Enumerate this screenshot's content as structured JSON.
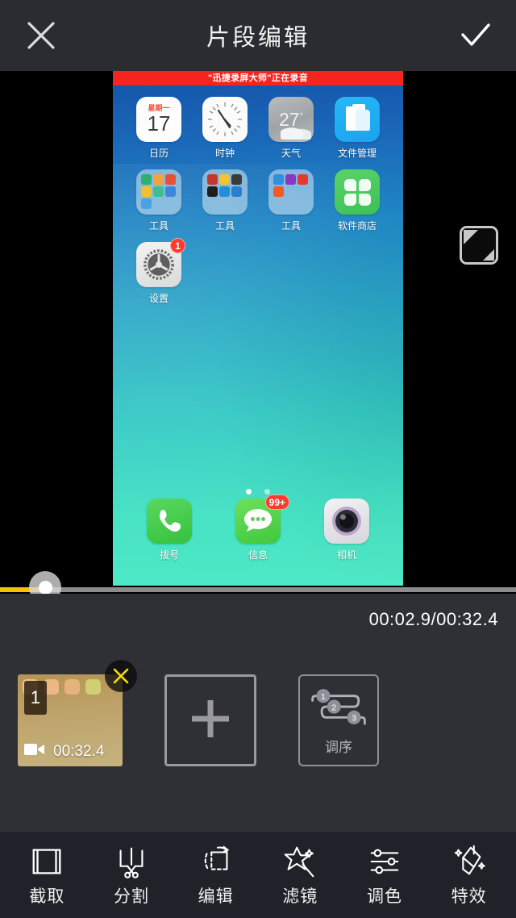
{
  "header": {
    "title": "片段编辑",
    "close_icon": "close-x-icon",
    "confirm_icon": "check-icon"
  },
  "corner_button": {
    "icon": "contrast-split-icon"
  },
  "preview": {
    "recording_banner": "\"迅捷录屏大师\"正在录音",
    "rows": [
      [
        {
          "label": "日历",
          "icon": "calendar-icon",
          "weekday": "星期一",
          "day": "17"
        },
        {
          "label": "时钟",
          "icon": "clock-icon"
        },
        {
          "label": "天气",
          "icon": "weather-icon",
          "temp": "27",
          "deg": "°"
        },
        {
          "label": "文件管理",
          "icon": "file-manager-icon"
        }
      ],
      [
        {
          "label": "工具",
          "icon": "folder-icon"
        },
        {
          "label": "工具",
          "icon": "folder-icon"
        },
        {
          "label": "工具",
          "icon": "folder-icon"
        },
        {
          "label": "软件商店",
          "icon": "app-store-icon"
        }
      ],
      [
        {
          "label": "设置",
          "icon": "settings-gear-icon",
          "badge": "1"
        }
      ]
    ],
    "page_dots": 2,
    "dock": [
      {
        "label": "拨号",
        "icon": "phone-icon"
      },
      {
        "label": "信息",
        "icon": "messages-icon",
        "badge": "99+"
      },
      {
        "label": "相机",
        "icon": "camera-icon"
      }
    ]
  },
  "playback": {
    "current_time": "00:02.9",
    "total_time": "00:32.4",
    "time_display": "00:02.9/00:32.4",
    "progress_percent": 9,
    "fill_color": "#f3c300",
    "track_color": "#8c8c8c"
  },
  "tray": {
    "clip": {
      "index": "1",
      "duration": "00:32.4",
      "video_icon": "video-camera-icon",
      "delete_icon": "delete-x-icon",
      "delete_color": "#f6e300"
    },
    "add_label": "",
    "add_icon": "plus-icon",
    "order": {
      "label": "调序",
      "icon": "reorder-flow-icon",
      "steps": [
        "1",
        "2",
        "3"
      ]
    }
  },
  "toolbar": [
    {
      "label": "截取",
      "icon": "crop-brackets-icon"
    },
    {
      "label": "分割",
      "icon": "scissors-icon"
    },
    {
      "label": "编辑",
      "icon": "rotate-crop-icon"
    },
    {
      "label": "滤镜",
      "icon": "magic-wand-icon"
    },
    {
      "label": "调色",
      "icon": "sliders-icon"
    },
    {
      "label": "特效",
      "icon": "brush-sparkle-icon"
    }
  ]
}
